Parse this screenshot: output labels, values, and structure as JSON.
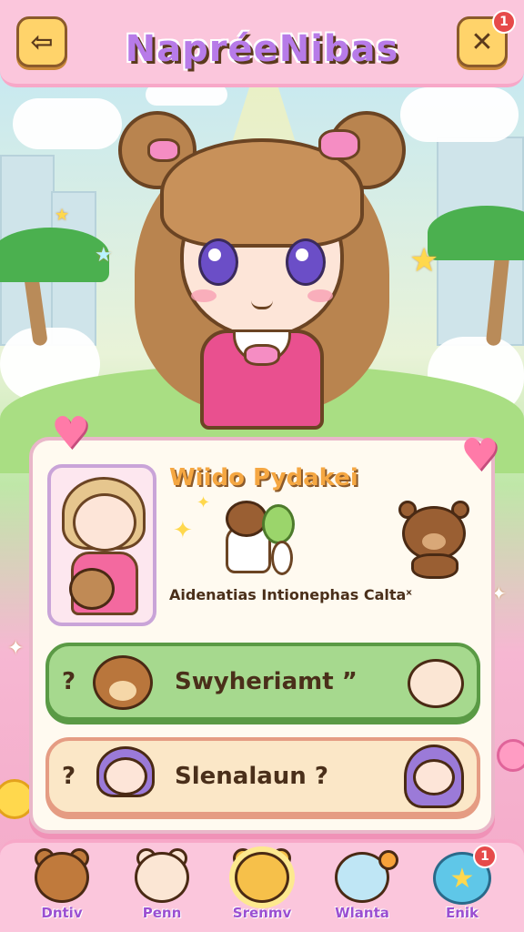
{
  "header": {
    "title": "NapréeNibas",
    "back_icon": "back-arrow-icon",
    "close_icon": "close-x-icon",
    "close_badge": "1"
  },
  "character_card": {
    "name": "Wiido Pydakei",
    "description": "Aidenatias Intionephas Caltaˣ"
  },
  "options": [
    {
      "prefix": "?",
      "label": "Swyheriamt ”"
    },
    {
      "prefix": "?",
      "label": "Slenalaun ?"
    }
  ],
  "bottom_nav": [
    {
      "label": "Dntiv",
      "icon": "fox-icon"
    },
    {
      "label": "Penn",
      "icon": "bunny-icon"
    },
    {
      "label": "Srenmv",
      "icon": "bear-icon"
    },
    {
      "label": "Wlanta",
      "icon": "seal-icon"
    },
    {
      "label": "Enik",
      "icon": "star-icon",
      "badge": "1"
    }
  ],
  "colors": {
    "frame_pink": "#fbc6dc",
    "title_purple": "#b77be8",
    "accent_gold": "#f5a742",
    "option_green": "#a6d98e",
    "option_cream": "#fbe7c7"
  }
}
